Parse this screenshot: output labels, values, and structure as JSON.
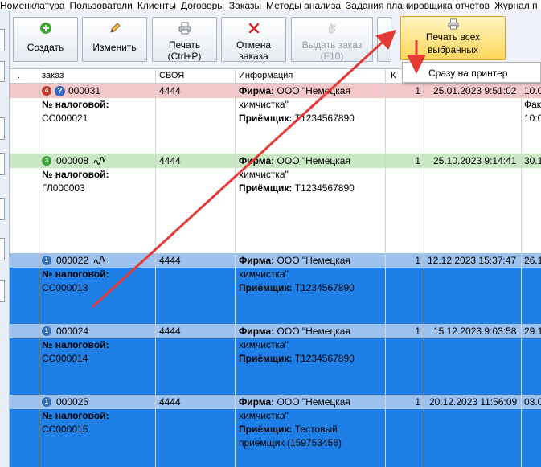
{
  "menu": [
    "Номенклатура",
    "Пользователи",
    "Клиенты",
    "Договоры",
    "Заказы",
    "Методы анализа",
    "Задания планировщика отчетов",
    "Журнал п"
  ],
  "toolbar": {
    "create": "Создать",
    "edit": "Изменить",
    "print_line1": "Печать",
    "print_line2": "(Ctrl+P)",
    "cancel_line1": "Отмена",
    "cancel_line2": "заказа",
    "issue_line1": "Выдать заказ",
    "issue_line2": "(F10)",
    "print_all_line1": "Печать всех",
    "print_all_line2": "выбранных"
  },
  "dropdown": {
    "item": "Сразу на принтер"
  },
  "columns": [
    ".",
    "заказ",
    "СВОЯ",
    "Информация",
    "К"
  ],
  "rows": [
    {
      "badge": "4",
      "order": "000031",
      "svoya": "4444",
      "tax_label": "№ налоговой:",
      "tax_value": "СС000021",
      "firm_label": "Фирма:",
      "firm_line1": "ООО \"Немецкая",
      "firm_line2": "химчистка\"",
      "recv_label": "Приёмщик:",
      "recv_value": "T1234567890",
      "qty": "1",
      "date": "25.01.2023 9:51:02",
      "extra1": "10.0",
      "extra2": "Фак",
      "extra3": "10:0"
    },
    {
      "badge": "3",
      "order": "000008",
      "svoya": "4444",
      "tax_label": "№ налоговой:",
      "tax_value": "ГЛ000003",
      "firm_label": "Фирма:",
      "firm_line1": "ООО \"Немецкая",
      "firm_line2": "химчистка\"",
      "recv_label": "Приёмщик:",
      "recv_value": "T1234567890",
      "qty": "1",
      "date": "25.10.2023 9:14:41",
      "extra1": "30.1"
    },
    {
      "badge": "1",
      "order": "000022",
      "svoya": "4444",
      "tax_label": "№ налоговой:",
      "tax_value": "СС000013",
      "firm_label": "Фирма:",
      "firm_line1": "ООО \"Немецкая",
      "firm_line2": "химчистка\"",
      "recv_label": "Приёмщик:",
      "recv_value": "T1234567890",
      "qty": "1",
      "date": "12.12.2023 15:37:47",
      "extra1": "26.1"
    },
    {
      "badge": "1",
      "order": "000024",
      "svoya": "4444",
      "tax_label": "№ налоговой:",
      "tax_value": "СС000014",
      "firm_label": "Фирма:",
      "firm_line1": "ООО \"Немецкая",
      "firm_line2": "химчистка\"",
      "recv_label": "Приёмщик:",
      "recv_value": "T1234567890",
      "qty": "1",
      "date": "15.12.2023 9:03:58",
      "extra1": "29.1"
    },
    {
      "badge": "1",
      "order": "000025",
      "svoya": "4444",
      "tax_label": "№ налоговой:",
      "tax_value": "СС000015",
      "firm_label": "Фирма:",
      "firm_line1": "ООО \"Немецкая",
      "firm_line2": "химчистка\"",
      "recv_label": "Приёмщик:",
      "recv_value": "Тестовый",
      "recv_value2": "приемщик (159753456)",
      "qty": "1",
      "date": "20.12.2023 11:56:09",
      "extra1": "03.0"
    }
  ],
  "colors": {
    "pink_band": "#f4c8c8",
    "green_band": "#c9e8c4",
    "selected_band": "#9dc2ef",
    "selected_body": "#1e7fe6",
    "active_button": "#ffd75a",
    "arrow": "#e53935"
  }
}
